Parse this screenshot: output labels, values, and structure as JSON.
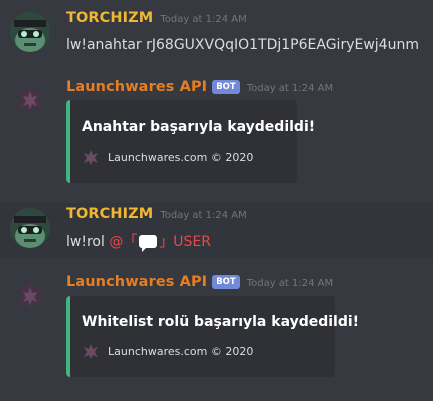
{
  "colors": {
    "background": "#36393f",
    "user_name": "#f0b732",
    "bot_name": "#e67e22",
    "bot_tag": "#7289da",
    "embed_accent": "#43b581",
    "embed_bg": "#2f3136",
    "mention": "#e8484b"
  },
  "messages": [
    {
      "author": "TORCHIZM",
      "timestamp": "Today at 1:24 AM",
      "text": "lw!anahtar rJ68GUXVQqIO1TDj1P6EAGiryEwj4unm",
      "avatar_icon": "robot-avatar-icon"
    },
    {
      "author": "Launchwares API",
      "bot_tag": "BOT",
      "timestamp": "Today at 1:24 AM",
      "avatar_icon": "launchwares-logo-icon",
      "embed": {
        "title": "Anahtar başarıyla kaydedildi!",
        "footer": "Launchwares.com © 2020"
      }
    },
    {
      "author": "TORCHIZM",
      "timestamp": "Today at 1:24 AM",
      "command": "lw!rol",
      "mention_prefix": "@「",
      "mention_icon": "chat-bubble-icon",
      "mention_suffix": "」USER",
      "avatar_icon": "robot-avatar-icon"
    },
    {
      "author": "Launchwares API",
      "bot_tag": "BOT",
      "timestamp": "Today at 1:24 AM",
      "avatar_icon": "launchwares-logo-icon",
      "embed": {
        "title": "Whitelist rolü başarıyla kaydedildi!",
        "footer": "Launchwares.com © 2020"
      }
    }
  ]
}
